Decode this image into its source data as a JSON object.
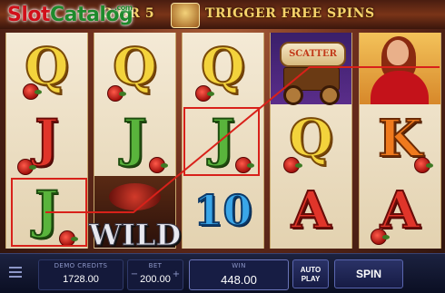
{
  "banner": {
    "left_text": "3 OR 5",
    "right_text": "TRIGGER FREE SPINS"
  },
  "watermark": {
    "part1": "Slot",
    "part2": "Catalog",
    "suffix": ".com"
  },
  "reels": [
    [
      "Q",
      "J",
      "J"
    ],
    [
      "Q",
      "J",
      "WILD"
    ],
    [
      "Q",
      "J",
      "10"
    ],
    [
      "SCATTER",
      "Q",
      "A"
    ],
    [
      "LADY",
      "K",
      "A"
    ]
  ],
  "scatter_label": "SCATTER",
  "wild_label": "WILD",
  "colors": {
    "payline": "#d8211a",
    "scatter_bg": "#4a2680"
  },
  "controls": {
    "demo_credits_label": "DEMO CREDITS",
    "demo_credits_value": "1728.00",
    "bet_label": "BET",
    "bet_value": "200.00",
    "win_label": "WIN",
    "win_value": "448.00",
    "auto_play_line1": "AUTO",
    "auto_play_line2": "PLAY",
    "spin_label": "SPIN",
    "bet_decrease_icon": "minus",
    "bet_increase_icon": "plus",
    "menu_icon": "hamburger-menu"
  }
}
